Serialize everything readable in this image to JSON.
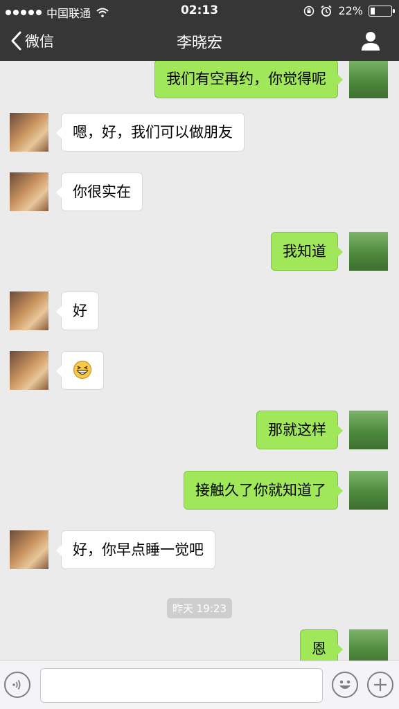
{
  "status_bar": {
    "carrier": "中国联通",
    "time": "02:13",
    "battery": "22%",
    "battery_level": 0.22
  },
  "nav": {
    "back_label": "微信",
    "title": "李晓宏"
  },
  "messages": [
    {
      "sender": "self",
      "text": "我们有空再约，你觉得呢"
    },
    {
      "sender": "other",
      "text": "嗯，好，我们可以做朋友"
    },
    {
      "sender": "other",
      "text": "你很实在"
    },
    {
      "sender": "self",
      "text": "我知道"
    },
    {
      "sender": "other",
      "text": "好"
    },
    {
      "sender": "other",
      "icon": "grinning-emoji-icon"
    },
    {
      "sender": "self",
      "text": "那就这样"
    },
    {
      "sender": "self",
      "text": "接触久了你就知道了"
    },
    {
      "sender": "other",
      "text": "好，你早点睡一觉吧"
    },
    {
      "sender": "self",
      "text": "恩"
    }
  ],
  "timestamp": "昨天 19:23",
  "colors": {
    "header_bg": "#363636",
    "chat_bg": "#ebebeb",
    "self_bubble": "#a0e75a",
    "other_bubble": "#ffffff"
  },
  "input_bar": {
    "value": "",
    "icons": [
      "voice-icon",
      "emoji-face-icon",
      "plus-icon"
    ]
  }
}
